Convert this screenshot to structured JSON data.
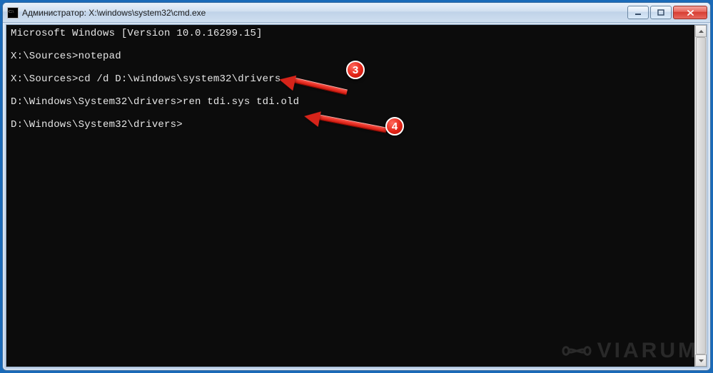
{
  "window": {
    "title": "Администратор: X:\\windows\\system32\\cmd.exe"
  },
  "terminal": {
    "lines": [
      {
        "prompt": "",
        "text": "Microsoft Windows [Version 10.0.16299.15]"
      },
      {
        "prompt": "",
        "text": ""
      },
      {
        "prompt": "X:\\Sources>",
        "text": "notepad"
      },
      {
        "prompt": "",
        "text": ""
      },
      {
        "prompt": "X:\\Sources>",
        "text": "cd /d D:\\windows\\system32\\drivers"
      },
      {
        "prompt": "",
        "text": ""
      },
      {
        "prompt": "D:\\Windows\\System32\\drivers>",
        "text": "ren tdi.sys tdi.old"
      },
      {
        "prompt": "",
        "text": ""
      },
      {
        "prompt": "D:\\Windows\\System32\\drivers>",
        "text": ""
      }
    ]
  },
  "callouts": {
    "c1": "3",
    "c2": "4"
  },
  "watermark": "VIARUM",
  "colors": {
    "accent_red": "#d63c30",
    "frame_blue": "#1a6ab8",
    "terminal_bg": "#0c0c0c",
    "terminal_fg": "#e6e6e6"
  }
}
